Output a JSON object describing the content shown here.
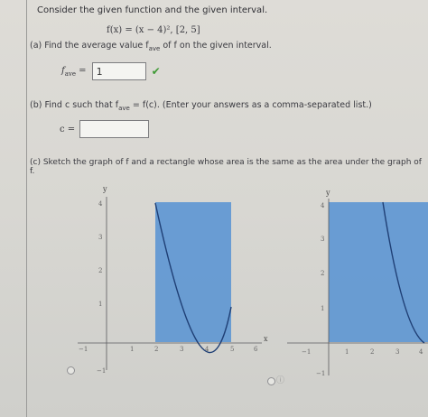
{
  "prompt": "Consider the given function and the given interval.",
  "function": "f(x) = (x − 4)²,   [2, 5]",
  "part_a": {
    "question": "(a)  Find the average value f",
    "sub": "ave",
    "question_tail": " of f on the given interval.",
    "label": "f",
    "label_sub": "ave",
    "equals": "=",
    "value": "1",
    "status": "correct"
  },
  "part_b": {
    "question": "(b)  Find c such that f",
    "sub": "ave",
    "question_tail": " = f(c). (Enter your answers as a comma-separated list.)",
    "label": "c =",
    "value": ""
  },
  "part_c": {
    "question": "(c)  Sketch the graph of f and a rectangle whose area is the same as the area under the graph of f."
  },
  "graphs": {
    "axis_y": "y",
    "axis_x": "x",
    "left_ticks_x": [
      "−1",
      "1",
      "2",
      "3",
      "4",
      "5",
      "6"
    ],
    "right_ticks_x": [
      "−1",
      "1",
      "2",
      "3",
      "4"
    ],
    "ticks_y": [
      "4",
      "3",
      "2",
      "1",
      "−1"
    ]
  },
  "colors": {
    "rect_fill": "#5f97d2",
    "curve": "#1f3f75",
    "check": "#3f9a35"
  }
}
